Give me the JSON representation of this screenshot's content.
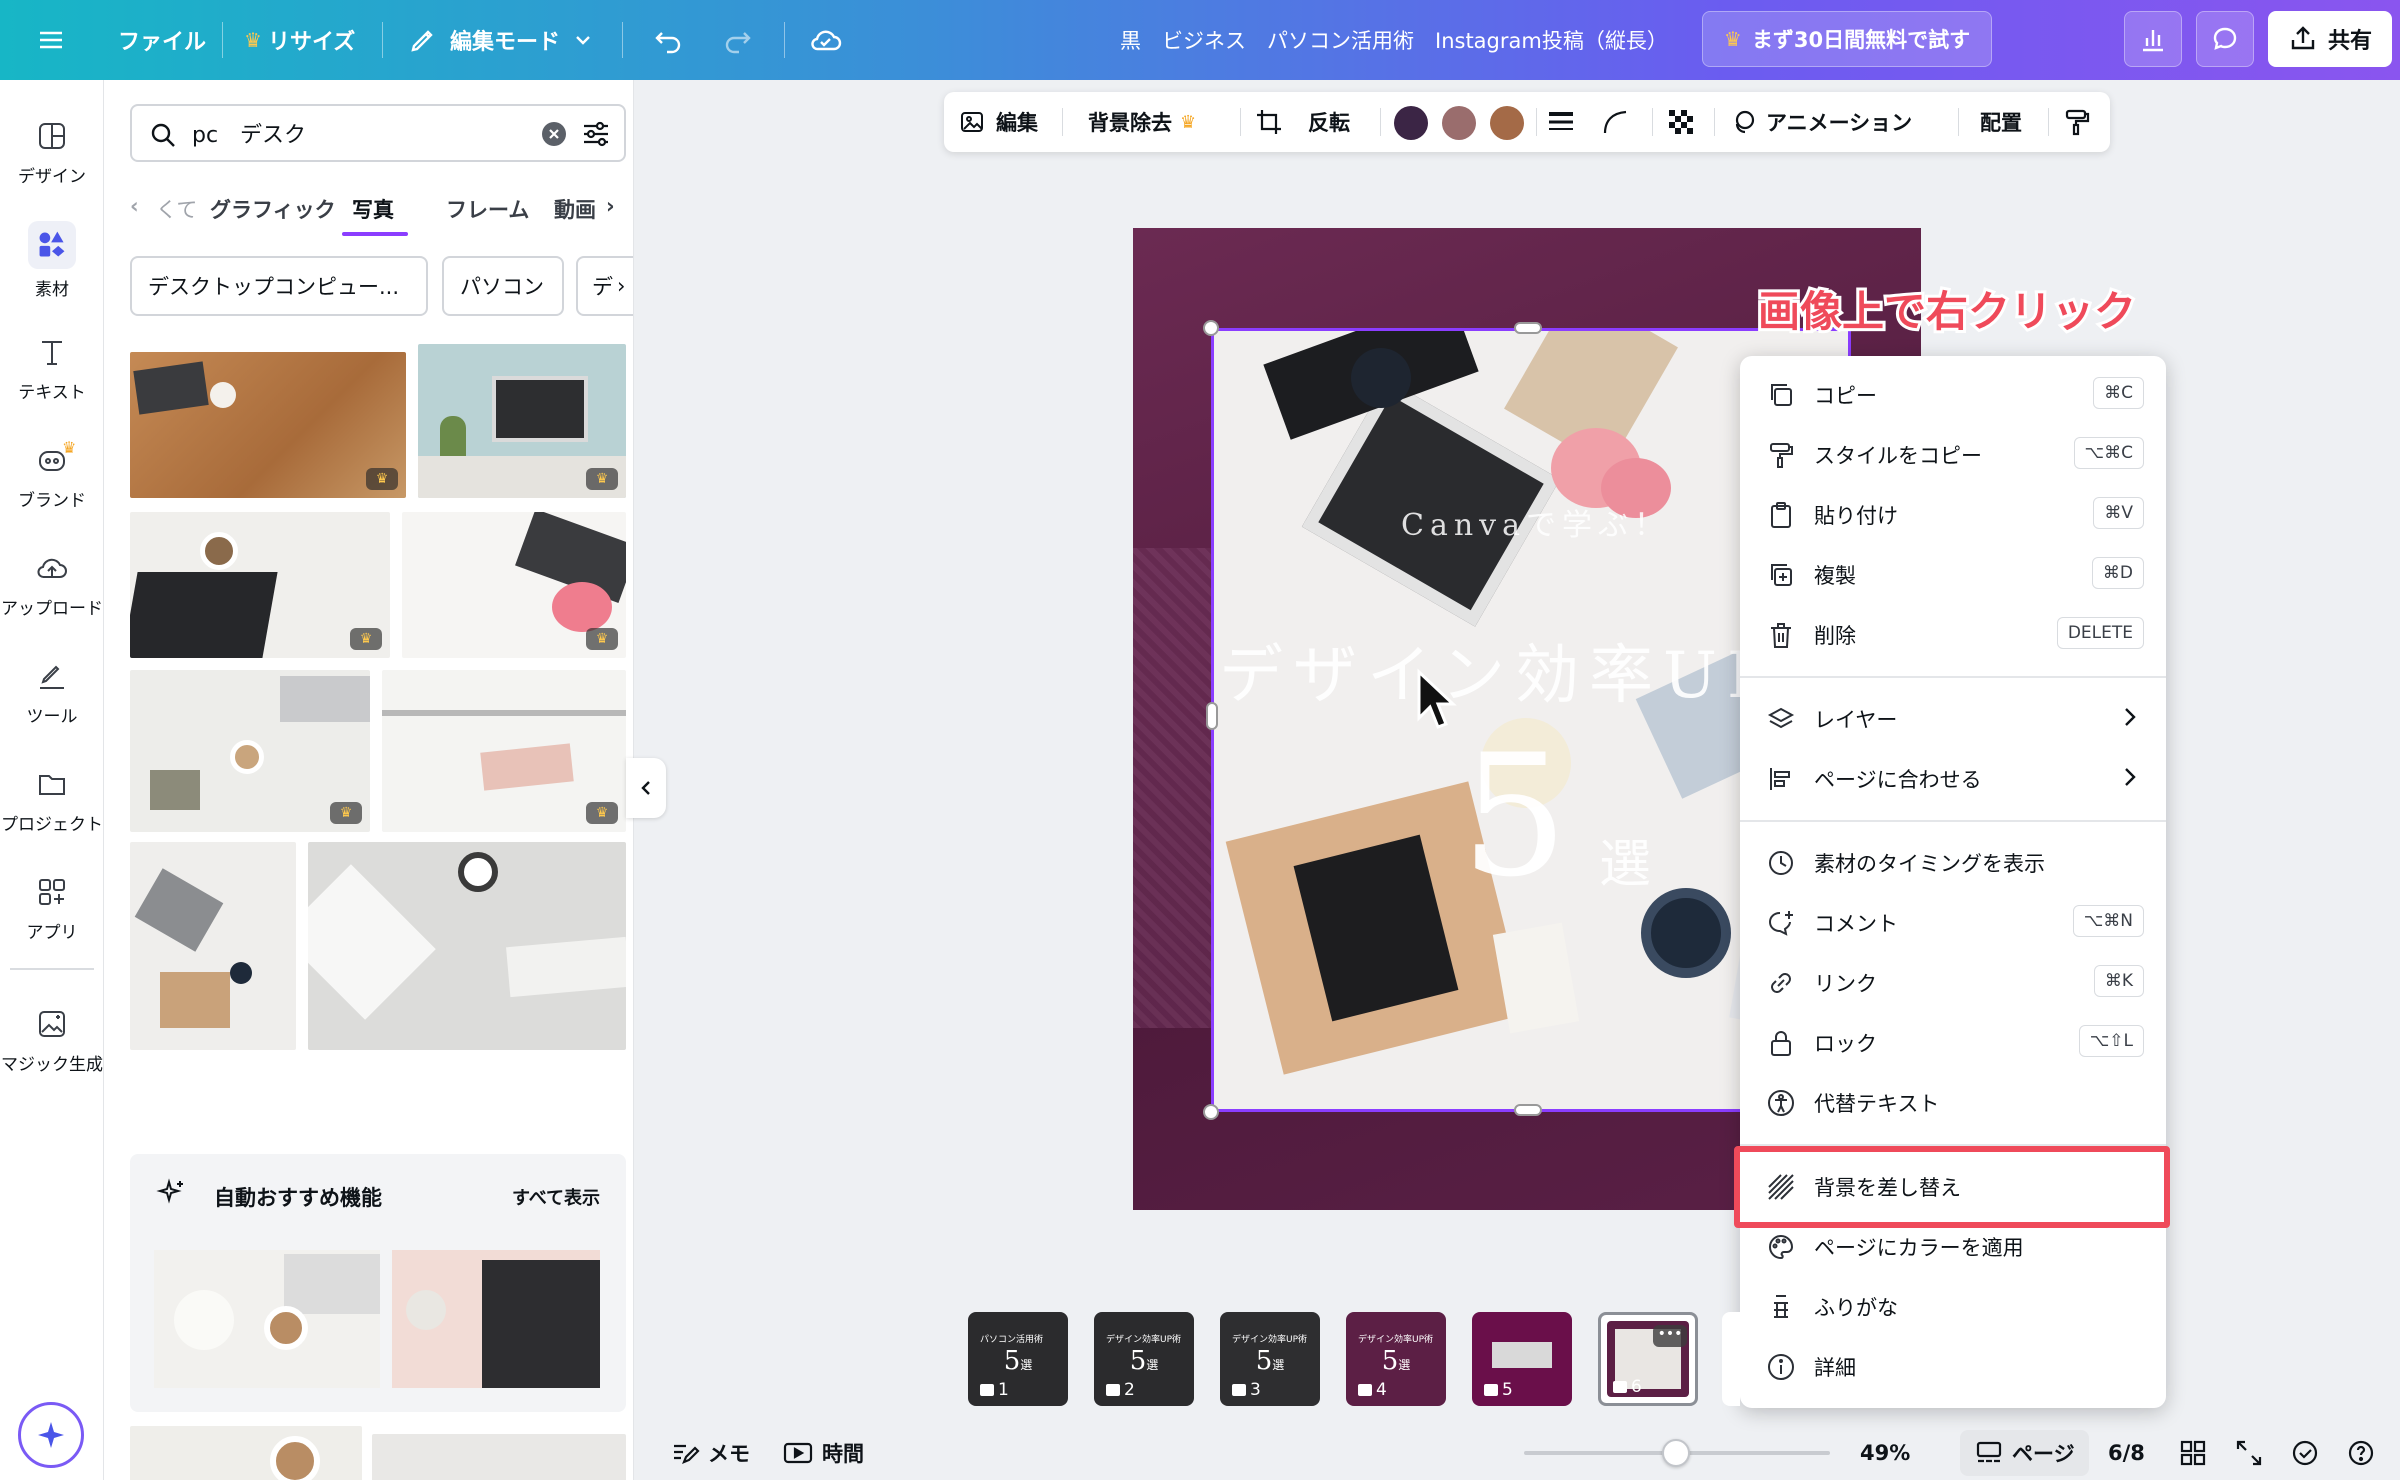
{
  "topbar": {
    "file": "ファイル",
    "resize": "リサイズ",
    "edit_mode": "編集モード",
    "doc_title": "黒　ビジネス　パソコン活用術　Instagram投稿（縦長）",
    "trial": "まず30日間無料で試す",
    "share": "共有"
  },
  "rail": {
    "items": [
      {
        "label": "デザイン"
      },
      {
        "label": "素材"
      },
      {
        "label": "テキスト"
      },
      {
        "label": "ブランド"
      },
      {
        "label": "アップロード"
      },
      {
        "label": "ツール"
      },
      {
        "label": "プロジェクト"
      },
      {
        "label": "アプリ"
      },
      {
        "label": "マジック生成"
      }
    ]
  },
  "panel": {
    "search_value": "pc　デスク",
    "tabs": [
      "くて",
      "グラフィック",
      "写真",
      "フレーム",
      "動画"
    ],
    "active_tab": "写真",
    "chips": [
      "デスクトップコンピュー...",
      "パソコン",
      "デ"
    ],
    "recommend_title": "自動おすすめ機能",
    "recommend_link": "すべて表示"
  },
  "toolbar": {
    "edit": "編集",
    "bg_remove": "背景除去",
    "flip": "反転",
    "animation": "アニメーション",
    "position": "配置",
    "colors": [
      "#3b2545",
      "#9a6d6d",
      "#a46a47"
    ]
  },
  "design": {
    "subtitle": "Canvaで学ぶ！",
    "headline": "デザイン効率UP",
    "number": "5",
    "suffix": "選"
  },
  "annotation": "画像上で右クリック",
  "context_menu": {
    "items": [
      {
        "label": "コピー",
        "shortcut": "⌘C",
        "icon": "copy-icon"
      },
      {
        "label": "スタイルをコピー",
        "shortcut": "⌥⌘C",
        "icon": "paint-roller-icon"
      },
      {
        "label": "貼り付け",
        "shortcut": "⌘V",
        "icon": "clipboard-icon"
      },
      {
        "label": "複製",
        "shortcut": "⌘D",
        "icon": "duplicate-icon"
      },
      {
        "label": "削除",
        "shortcut": "DELETE",
        "icon": "trash-icon"
      },
      {
        "label": "レイヤー",
        "icon": "layers-icon"
      },
      {
        "label": "ページに合わせる",
        "icon": "align-icon"
      },
      {
        "label": "素材のタイミングを表示",
        "icon": "clock-icon"
      },
      {
        "label": "コメント",
        "shortcut": "⌥⌘N",
        "icon": "comment-icon"
      },
      {
        "label": "リンク",
        "shortcut": "⌘K",
        "icon": "link-icon"
      },
      {
        "label": "ロック",
        "shortcut": "⌥⇧L",
        "icon": "lock-icon"
      },
      {
        "label": "代替テキスト",
        "icon": "accessibility-icon"
      },
      {
        "label": "背景を差し替え",
        "icon": "hatch-icon"
      },
      {
        "label": "ページにカラーを適用",
        "icon": "palette-icon"
      },
      {
        "label": "ふりがな",
        "icon": "furigana-icon"
      },
      {
        "label": "詳細",
        "icon": "info-icon"
      }
    ]
  },
  "thumbnails": [
    {
      "num": "1",
      "text": "パソコン活用術"
    },
    {
      "num": "2",
      "text": "デザイン効率UP術"
    },
    {
      "num": "3",
      "text": "デザイン効率UP術"
    },
    {
      "num": "4",
      "text": "デザイン効率UP術"
    },
    {
      "num": "5",
      "text": ""
    },
    {
      "num": "6",
      "text": ""
    }
  ],
  "bottombar": {
    "memo": "メモ",
    "time": "時間",
    "zoom": "49%",
    "zoom_level": 0.49,
    "pages": "ページ",
    "page_count": "6/8"
  }
}
